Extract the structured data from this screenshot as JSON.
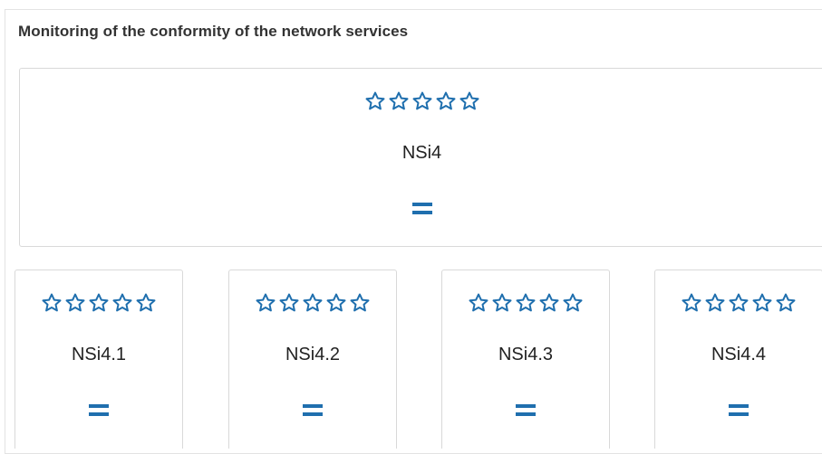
{
  "panel": {
    "title": "Monitoring of the conformity of the network services"
  },
  "colors": {
    "accent": "#1f6fae",
    "border": "#d9d9d9"
  },
  "main_indicator": {
    "label": "NSi4",
    "rating": 0,
    "max_rating": 5,
    "trend_icon": "equals-icon"
  },
  "sub_indicators": [
    {
      "label": "NSi4.1",
      "rating": 0,
      "max_rating": 5,
      "trend_icon": "equals-icon"
    },
    {
      "label": "NSi4.2",
      "rating": 0,
      "max_rating": 5,
      "trend_icon": "equals-icon"
    },
    {
      "label": "NSi4.3",
      "rating": 0,
      "max_rating": 5,
      "trend_icon": "equals-icon"
    },
    {
      "label": "NSi4.4",
      "rating": 0,
      "max_rating": 5,
      "trend_icon": "equals-icon"
    }
  ]
}
